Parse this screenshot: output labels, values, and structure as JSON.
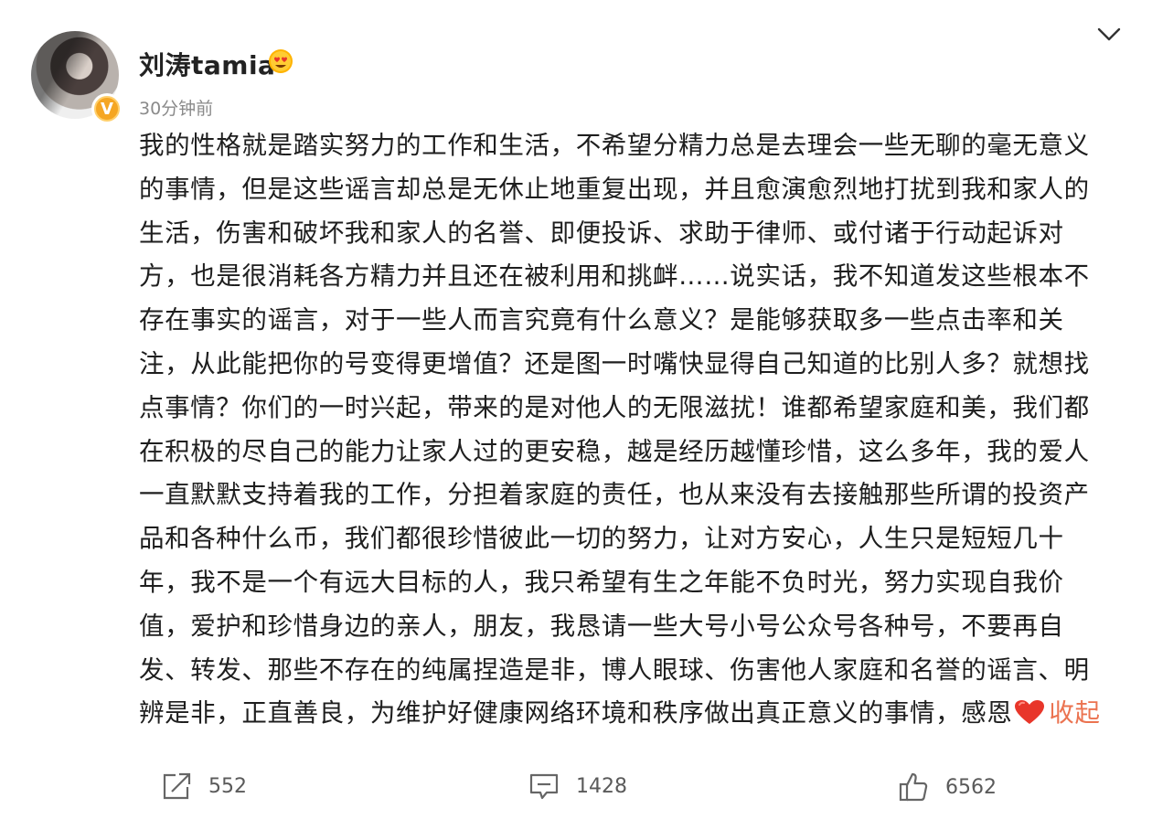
{
  "post": {
    "username": "刘涛tamia",
    "time": "30分钟前",
    "body": "我的性格就是踏实努力的工作和生活，不希望分精力总是去理会一些无聊的毫无意义的事情，但是这些谣言却总是无休止地重复出现，并且愈演愈烈地打扰到我和家人的生活，伤害和破坏我和家人的名誉、即便投诉、求助于律师、或付诸于行动起诉对方，也是很消耗各方精力并且还在被利用和挑衅……说实话，我不知道发这些根本不存在事实的谣言，对于一些人而言究竟有什么意义？是能够获取多一些点击率和关注，从此能把你的号变得更增值？还是图一时嘴快显得自己知道的比别人多？就想找点事情？你们的一时兴起，带来的是对他人的无限滋扰！谁都希望家庭和美，我们都在积极的尽自己的能力让家人过的更安稳，越是经历越懂珍惜，这么多年，我的爱人一直默默支持着我的工作，分担着家庭的责任，也从来没有去接触那些所谓的投资产品和各种什么币，我们都很珍惜彼此一切的努力，让对方安心，人生只是短短几十年，我不是一个有远大目标的人，我只希望有生之年能不负时光，努力实现自我价值，爱护和珍惜身边的亲人，朋友，我恳请一些大号小号公众号各种号，不要再自发、转发、那些不存在的纯属捏造是非，博人眼球、伤害他人家庭和名誉的谣言、明辨是非，正直善良，为维护好健康网络环境和秩序做出真正意义的事情，感恩",
    "collapse_label": "收起"
  },
  "actions": {
    "reposts": "552",
    "comments": "1428",
    "likes": "6562"
  },
  "icons": {
    "more": "chevron-down-icon",
    "verified": "verified-v-icon",
    "member": "heart-eyes-emoji-icon",
    "repost": "repost-icon",
    "comment": "comment-icon",
    "like": "thumbs-up-icon",
    "heart": "red-heart-emoji"
  },
  "colors": {
    "accent": "#eb7350",
    "verified": "#f5a623",
    "heart": "#e8362a",
    "muted": "#8a8a8a"
  }
}
